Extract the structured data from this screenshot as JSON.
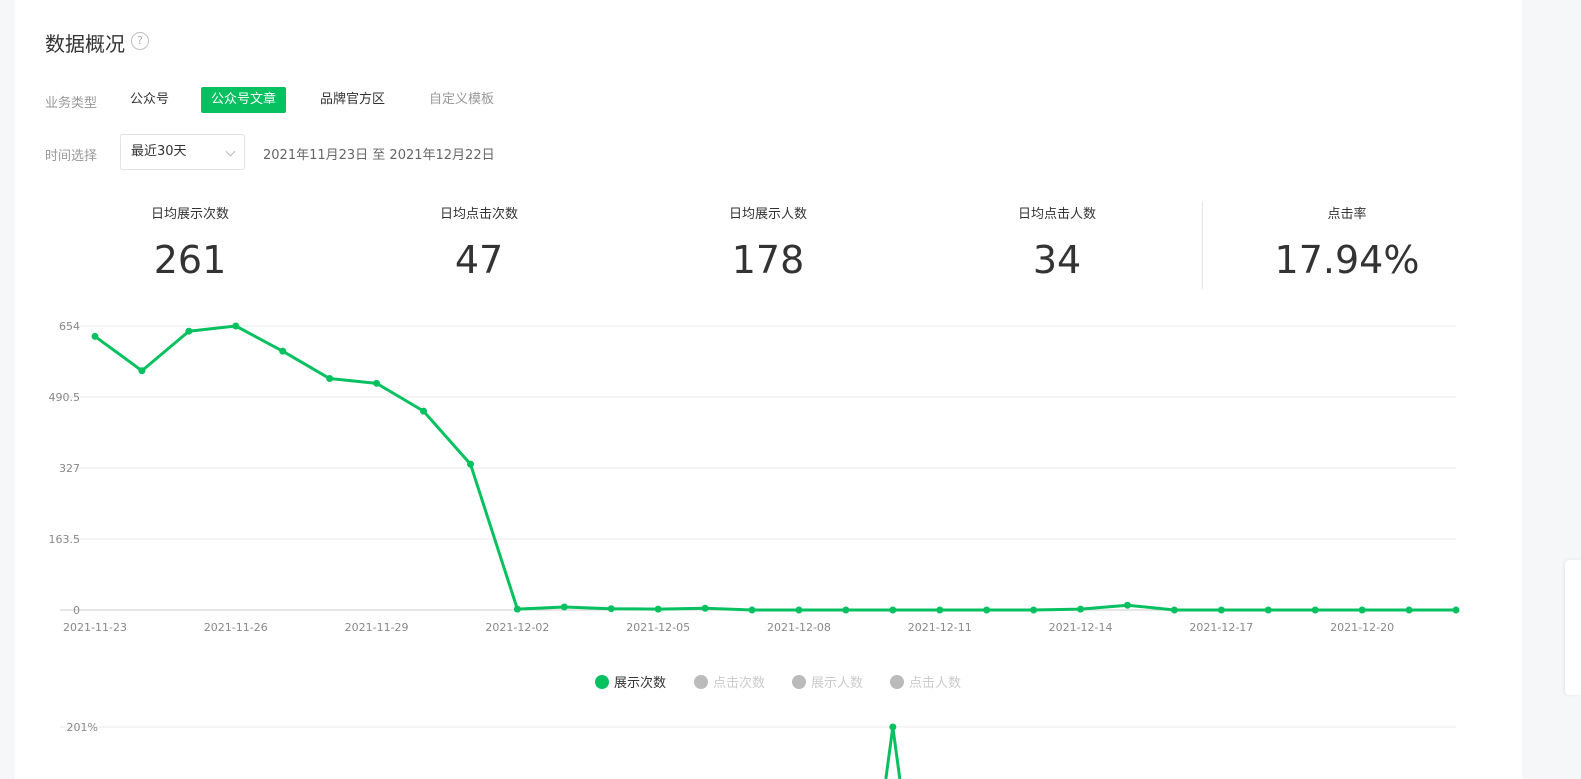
{
  "header": {
    "title": "数据概况",
    "help_icon": "question-circle-icon",
    "help_glyph": "?"
  },
  "filters": {
    "business_label": "业务类型",
    "business_tabs": [
      {
        "label": "公众号",
        "state": "normal"
      },
      {
        "label": "公众号文章",
        "state": "active"
      },
      {
        "label": "品牌官方区",
        "state": "normal"
      },
      {
        "label": "自定义模板",
        "state": "muted"
      }
    ],
    "time_label": "时间选择",
    "time_select": {
      "value": "最近30天",
      "icon": "chevron-down-icon"
    },
    "date_range": "2021年11月23日 至 2021年12月22日"
  },
  "metrics": [
    {
      "label": "日均展示次数",
      "value": "261"
    },
    {
      "label": "日均点击次数",
      "value": "47"
    },
    {
      "label": "日均展示人数",
      "value": "178"
    },
    {
      "label": "日均点击人数",
      "value": "34"
    },
    {
      "label": "点击率",
      "value": "17.94%"
    }
  ],
  "colors": {
    "accent": "#07c160",
    "legend_inactive": "#bbbbbb",
    "grid": "#e8e8e8"
  },
  "chart_data": [
    {
      "type": "line",
      "x": [
        "2021-11-23",
        "2021-11-24",
        "2021-11-25",
        "2021-11-26",
        "2021-11-27",
        "2021-11-28",
        "2021-11-29",
        "2021-11-30",
        "2021-12-01",
        "2021-12-02",
        "2021-12-03",
        "2021-12-04",
        "2021-12-05",
        "2021-12-06",
        "2021-12-07",
        "2021-12-08",
        "2021-12-09",
        "2021-12-10",
        "2021-12-11",
        "2021-12-12",
        "2021-12-13",
        "2021-12-14",
        "2021-12-15",
        "2021-12-16",
        "2021-12-17",
        "2021-12-18",
        "2021-12-19",
        "2021-12-20",
        "2021-12-21",
        "2021-12-22"
      ],
      "x_tick_labels": [
        "2021-11-23",
        "2021-11-26",
        "2021-11-29",
        "2021-12-02",
        "2021-12-05",
        "2021-12-08",
        "2021-12-11",
        "2021-12-14",
        "2021-12-17",
        "2021-12-20"
      ],
      "y_ticks": [
        "0",
        "163.5",
        "327",
        "490.5",
        "654"
      ],
      "ylim": [
        0,
        654
      ],
      "grid": true,
      "series": [
        {
          "name": "展示次数",
          "active": true,
          "values": [
            630,
            551,
            642,
            654,
            596,
            533,
            522,
            458,
            336,
            2,
            7,
            3,
            2,
            4,
            0,
            0,
            0,
            0,
            0,
            0,
            0,
            2,
            11,
            0,
            0,
            0,
            0,
            0,
            0,
            0
          ]
        }
      ],
      "legend": [
        {
          "name": "展示次数",
          "active": true
        },
        {
          "name": "点击次数",
          "active": false
        },
        {
          "name": "展示人数",
          "active": false
        },
        {
          "name": "点击人数",
          "active": false
        }
      ],
      "legend_position": "bottom-center"
    },
    {
      "type": "line",
      "y_ticks": [
        "201%"
      ],
      "ylim": [
        0,
        201
      ],
      "grid": true,
      "series": [
        {
          "visible_points": [
            {
              "x": "2021-12-10",
              "y": 201
            }
          ]
        }
      ]
    }
  ]
}
